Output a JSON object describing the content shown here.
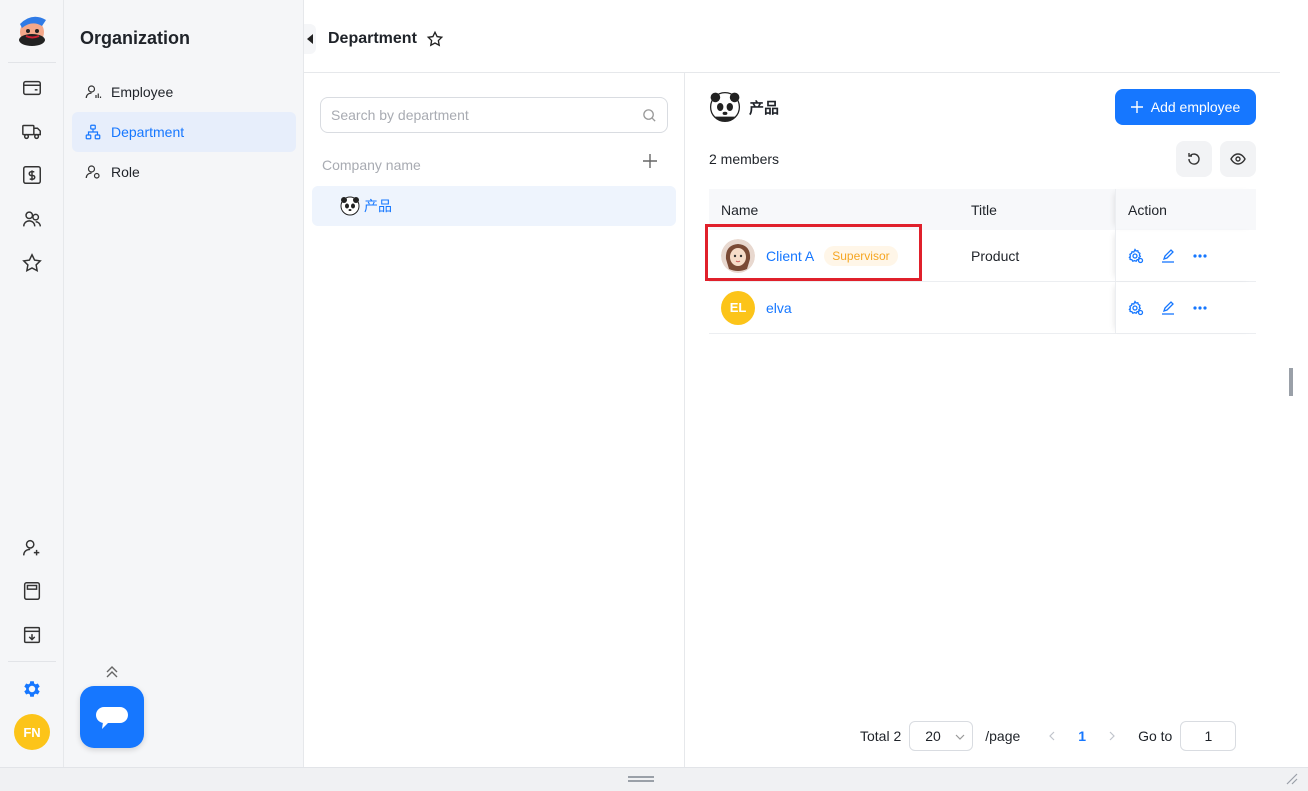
{
  "nav": {
    "title": "Organization",
    "items": [
      {
        "label": "Employee",
        "active": false
      },
      {
        "label": "Department",
        "active": true
      },
      {
        "label": "Role",
        "active": false
      }
    ]
  },
  "user": {
    "initials": "FN"
  },
  "header": {
    "title": "Department"
  },
  "search": {
    "placeholder": "Search by department"
  },
  "tree": {
    "company_label": "Company name",
    "departments": [
      {
        "name": "产品"
      }
    ]
  },
  "department": {
    "name": "产品",
    "member_count": "2 members",
    "add_button": "Add employee"
  },
  "table": {
    "columns": [
      "Name",
      "Title",
      "Action"
    ],
    "rows": [
      {
        "name": "Client A",
        "badge": "Supervisor",
        "title": "Product",
        "avatar": "photo"
      },
      {
        "name": "elva",
        "badge": "",
        "title": "",
        "avatar_initials": "EL",
        "avatar_color": "#fcc419"
      }
    ]
  },
  "pagination": {
    "total": "Total 2",
    "page_size": "20",
    "per_page": "/page",
    "current_page": "1",
    "goto_label": "Go to",
    "goto_value": "1"
  },
  "colors": {
    "accent": "#1677ff",
    "badge": "#f5a623",
    "highlight": "#e0202b"
  }
}
